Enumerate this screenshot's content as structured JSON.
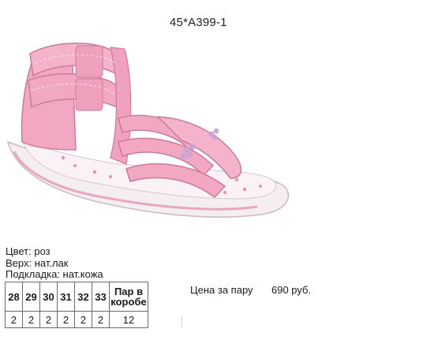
{
  "product": {
    "sku": "45*А399-1"
  },
  "attributes": [
    {
      "text": "Цвет: роз"
    },
    {
      "text": "Верх: нат.лак"
    },
    {
      "text": "Подкладка: нат.кожа"
    }
  ],
  "size_table": {
    "headers": [
      "28",
      "29",
      "30",
      "31",
      "32",
      "33"
    ],
    "box_header_line1": "Пар в",
    "box_header_line2": "коробе",
    "counts": [
      "2",
      "2",
      "2",
      "2",
      "2",
      "2"
    ],
    "box_total": "12"
  },
  "price": {
    "label": "Цена за пару",
    "value": "690 руб."
  },
  "colors": {
    "shoe_pink": "#f2a7c3",
    "shoe_pink_dark": "#d9839f",
    "sole_white": "#f4f1f2",
    "insole_print": "#e07aa0"
  },
  "image": {
    "subject": "pink-girls-sandal"
  }
}
